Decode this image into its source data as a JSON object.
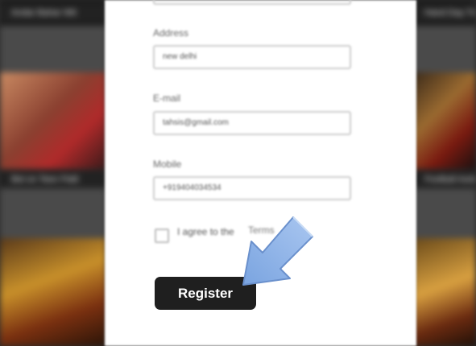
{
  "background": {
    "left_tiles": [
      {
        "caption": "Andar Bahar Wit"
      },
      {
        "caption": "Bet on Teen Patti"
      },
      {
        "caption": ""
      }
    ],
    "right_tiles": [
      {
        "caption": "Hand Day Tru"
      },
      {
        "caption": "Football Auto Ro"
      },
      {
        "caption": ""
      }
    ]
  },
  "form": {
    "address": {
      "label": "Address",
      "value": "new delhi"
    },
    "email": {
      "label": "E-mail",
      "value": "tahsis@gmail.com"
    },
    "mobile": {
      "label": "Mobile",
      "value": "+919404034534"
    },
    "agree_label": "I agree to the",
    "terms_label": "Terms",
    "register_label": "Register"
  },
  "colors": {
    "button_bg": "#1f1f1f",
    "arrow_fill": "#8fb4e8"
  },
  "icons": {
    "pointer": "arrow-pointer-icon",
    "checkbox": "checkbox-icon"
  }
}
